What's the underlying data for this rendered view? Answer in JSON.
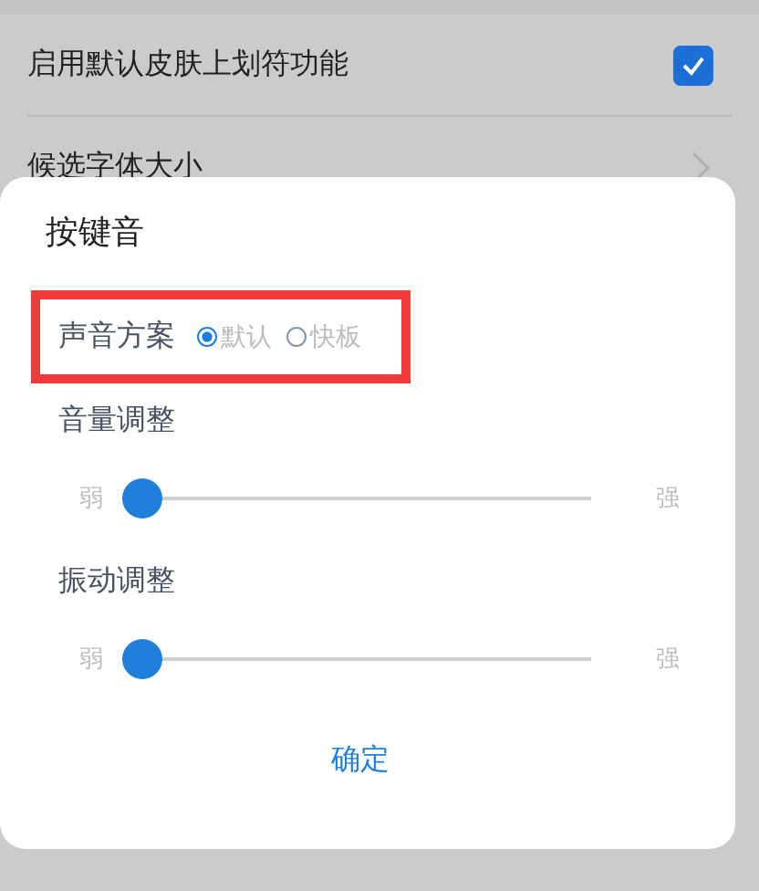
{
  "settings": [
    {
      "kind": "checkbox",
      "label": "启用默认皮肤上划符功能",
      "checked": true
    },
    {
      "kind": "link",
      "label": "候选字体大小"
    }
  ],
  "dialog": {
    "title": "按键音",
    "scheme": {
      "label": "声音方案",
      "highlighted": true,
      "options": [
        {
          "label": "默认",
          "selected": true
        },
        {
          "label": "快板",
          "selected": false
        }
      ]
    },
    "sliders": [
      {
        "label": "音量调整",
        "min_label": "弱",
        "max_label": "强",
        "level": 0
      },
      {
        "label": "振动调整",
        "min_label": "弱",
        "max_label": "强",
        "level": 0
      }
    ],
    "button": "确定"
  }
}
